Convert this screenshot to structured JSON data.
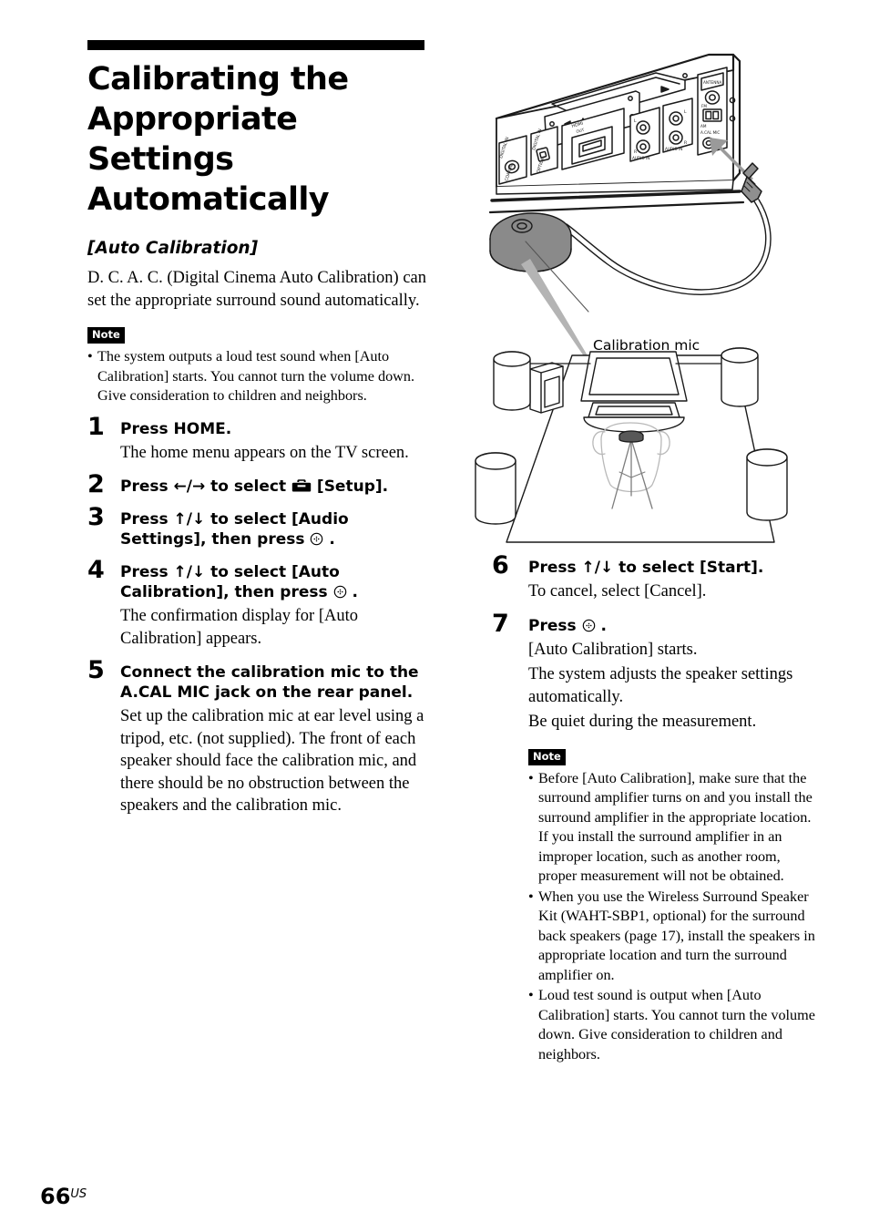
{
  "page": {
    "number": "66",
    "number_suffix": "US"
  },
  "left": {
    "title": "Calibrating the Appropriate Settings Automatically",
    "subtitle": "[Auto Calibration]",
    "intro": "D. C. A. C. (Digital Cinema Auto Calibration) can set the appropriate surround sound automatically.",
    "note": {
      "badge": "Note",
      "items": [
        "The system outputs a loud test sound when [Auto Calibration] starts. You cannot turn the volume down. Give consideration to children and neighbors."
      ]
    },
    "steps": [
      {
        "num": "1",
        "head_pre": "Press HOME.",
        "head_post": "",
        "body": "The home menu appears on the TV screen."
      },
      {
        "num": "2",
        "head_pre": "Press ←/→ to select ",
        "head_post": " [Setup].",
        "body": ""
      },
      {
        "num": "3",
        "head_pre": "Press ↑/↓ to select [Audio Settings], then press ",
        "head_post": " .",
        "body": ""
      },
      {
        "num": "4",
        "head_pre": "Press ↑/↓ to select [Auto Calibration], then press ",
        "head_post": " .",
        "body": "The confirmation display for [Auto Calibration] appears."
      },
      {
        "num": "5",
        "head_pre": "Connect the calibration mic to the A.CAL MIC jack on the rear panel.",
        "head_post": "",
        "body": "Set up the calibration mic at ear level using a tripod, etc. (not supplied). The front of each speaker should face the calibration mic, and there should be no obstruction between the speakers and the calibration mic."
      }
    ]
  },
  "right": {
    "steps": [
      {
        "num": "6",
        "head_pre": "Press ↑/↓ to select [Start].",
        "head_post": "",
        "body_lines": [
          "To cancel, select [Cancel]."
        ]
      },
      {
        "num": "7",
        "head_pre": "Press ",
        "head_post": " .",
        "body_lines": [
          "[Auto Calibration] starts.",
          "The system adjusts the speaker settings automatically.",
          "Be quiet during the measurement."
        ]
      }
    ],
    "note": {
      "badge": "Note",
      "items": [
        "Before [Auto Calibration], make sure that the surround amplifier turns on and you install the surround amplifier in the appropriate location. If you install the surround amplifier in an improper location, such as another room, proper measurement will not be obtained.",
        "When you use the Wireless Surround Speaker Kit (WAHT-SBP1, optional) for the surround back speakers (page 17), install the speakers in appropriate location and turn the surround amplifier on.",
        "Loud test sound is output when [Auto Calibration] starts. You cannot turn the volume down. Give consideration to children and neighbors."
      ]
    }
  },
  "figure": {
    "caption_calibration_mic": "Calibration mic",
    "icons": {
      "setup": "toolbox-icon",
      "enter": "enter-button-icon",
      "warning": "warning-triangle-icon"
    },
    "colors": {
      "line": "#1a1a1a",
      "mic_body": "#8a8a8a",
      "arrow": "#9a9a9a",
      "plug": "#8f8f8f"
    }
  }
}
